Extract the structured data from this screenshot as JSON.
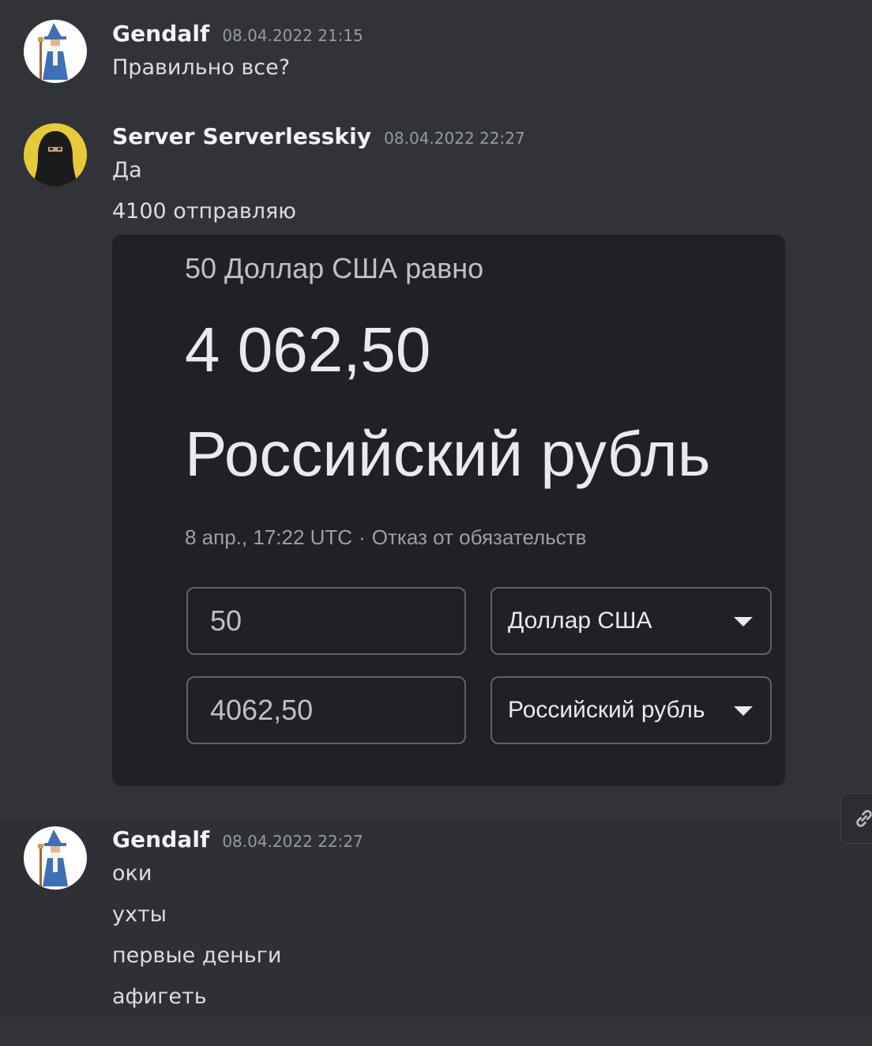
{
  "messages": [
    {
      "author": "Gendalf",
      "timestamp": "08.04.2022 21:15",
      "avatar": "wizard-avatar",
      "lines": [
        "Правильно все?"
      ]
    },
    {
      "author": "Server Serverlesskiy",
      "timestamp": "08.04.2022 22:27",
      "avatar": "hooded-figure-avatar",
      "lines": [
        "Да",
        "4100 отправляю"
      ],
      "attachment": {
        "equals_line": "50 Доллар США равно",
        "result_amount": "4 062,50",
        "result_currency": "Российский рубль",
        "date_time": "8 апр., 17:22 UTC",
        "separator": "·",
        "disclaimer": "Отказ от обязательств",
        "from_amount": "50",
        "from_currency": "Доллар США",
        "to_amount": "4062,50",
        "to_currency": "Российский рубль"
      }
    },
    {
      "author": "Gendalf",
      "timestamp": "08.04.2022 22:27",
      "avatar": "wizard-avatar",
      "lines": [
        "оки",
        "ухты",
        "первые деньги",
        "афигеть"
      ]
    }
  ],
  "hover_actions": {
    "icon": "link-icon"
  },
  "colors": {
    "background": "#313338",
    "hover_background": "#2e3035",
    "username": "#f2f3f5",
    "timestamp": "#949ba4",
    "text": "#dbdee1",
    "embed_background": "#202124"
  }
}
